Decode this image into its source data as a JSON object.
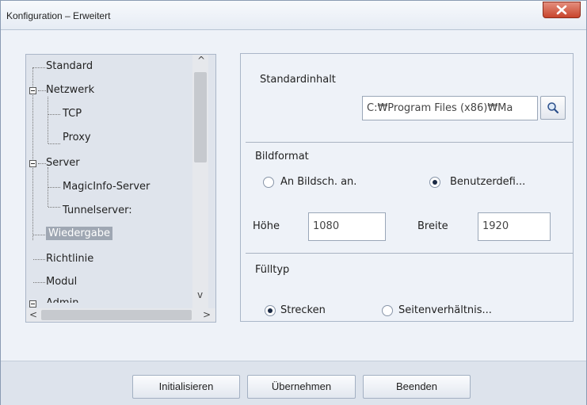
{
  "window": {
    "title": "Konfiguration – Erweitert"
  },
  "tree": {
    "items": [
      {
        "label": "Standard"
      },
      {
        "label": "Netzwerk"
      },
      {
        "label": "TCP"
      },
      {
        "label": "Proxy"
      },
      {
        "label": "Server"
      },
      {
        "label": "MagicInfo-Server"
      },
      {
        "label": "Tunnelserver:"
      },
      {
        "label": "Wiedergabe",
        "selected": true
      },
      {
        "label": "Richtlinie"
      },
      {
        "label": "Modul"
      },
      {
        "label": "Admin"
      }
    ]
  },
  "settings": {
    "content_label": "Standardinhalt",
    "content_path": "C:₩Program Files (x86)₩Ma",
    "image_format_label": "Bildformat",
    "format_options": [
      "An Bildsch. an.",
      "Benutzerdefi..."
    ],
    "format_selected": "Benutzerdefi...",
    "height_label": "Höhe",
    "height_value": "1080",
    "width_label": "Breite",
    "width_value": "1920",
    "fill_type_label": "Fülltyp",
    "fill_options": [
      "Strecken",
      "Seitenverhältnis..."
    ],
    "fill_selected": "Strecken"
  },
  "buttons": {
    "initialize": "Initialisieren",
    "apply": "Übernehmen",
    "exit": "Beenden"
  },
  "icons": [
    "close-icon",
    "magnifier-icon",
    "scroll-up-arrow-icon",
    "scroll-down-arrow-icon",
    "scroll-left-arrow-icon",
    "scroll-right-arrow-icon"
  ]
}
